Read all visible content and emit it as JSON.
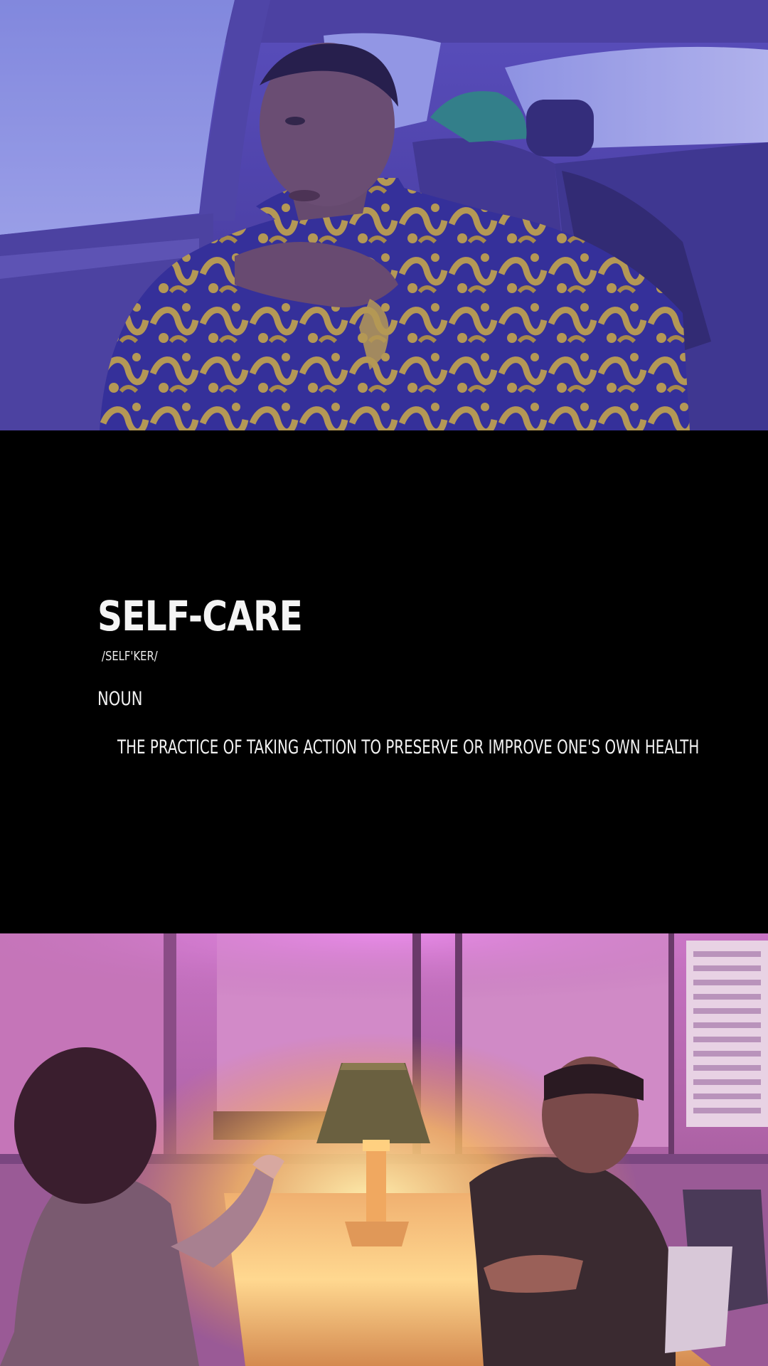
{
  "definition": {
    "word": "SELF-CARE",
    "pronunciation": "/SELF'KER/",
    "part_of_speech": "NOUN",
    "meaning": "THE PRACTICE OF TAKING ACTION TO PRESERVE OR IMPROVE ONE'S OWN HEALTH"
  },
  "scenes": {
    "top": {
      "type": "photo",
      "palette": {
        "tint": "#5a4fb8",
        "jacket_gold": "#c9a93a",
        "jacket_blue": "#2f2a8c"
      }
    },
    "bottom": {
      "type": "photo",
      "palette": {
        "wall": "#c873c4",
        "lamp_glow": "#ffd27a",
        "table": "#e8a45a"
      }
    }
  }
}
